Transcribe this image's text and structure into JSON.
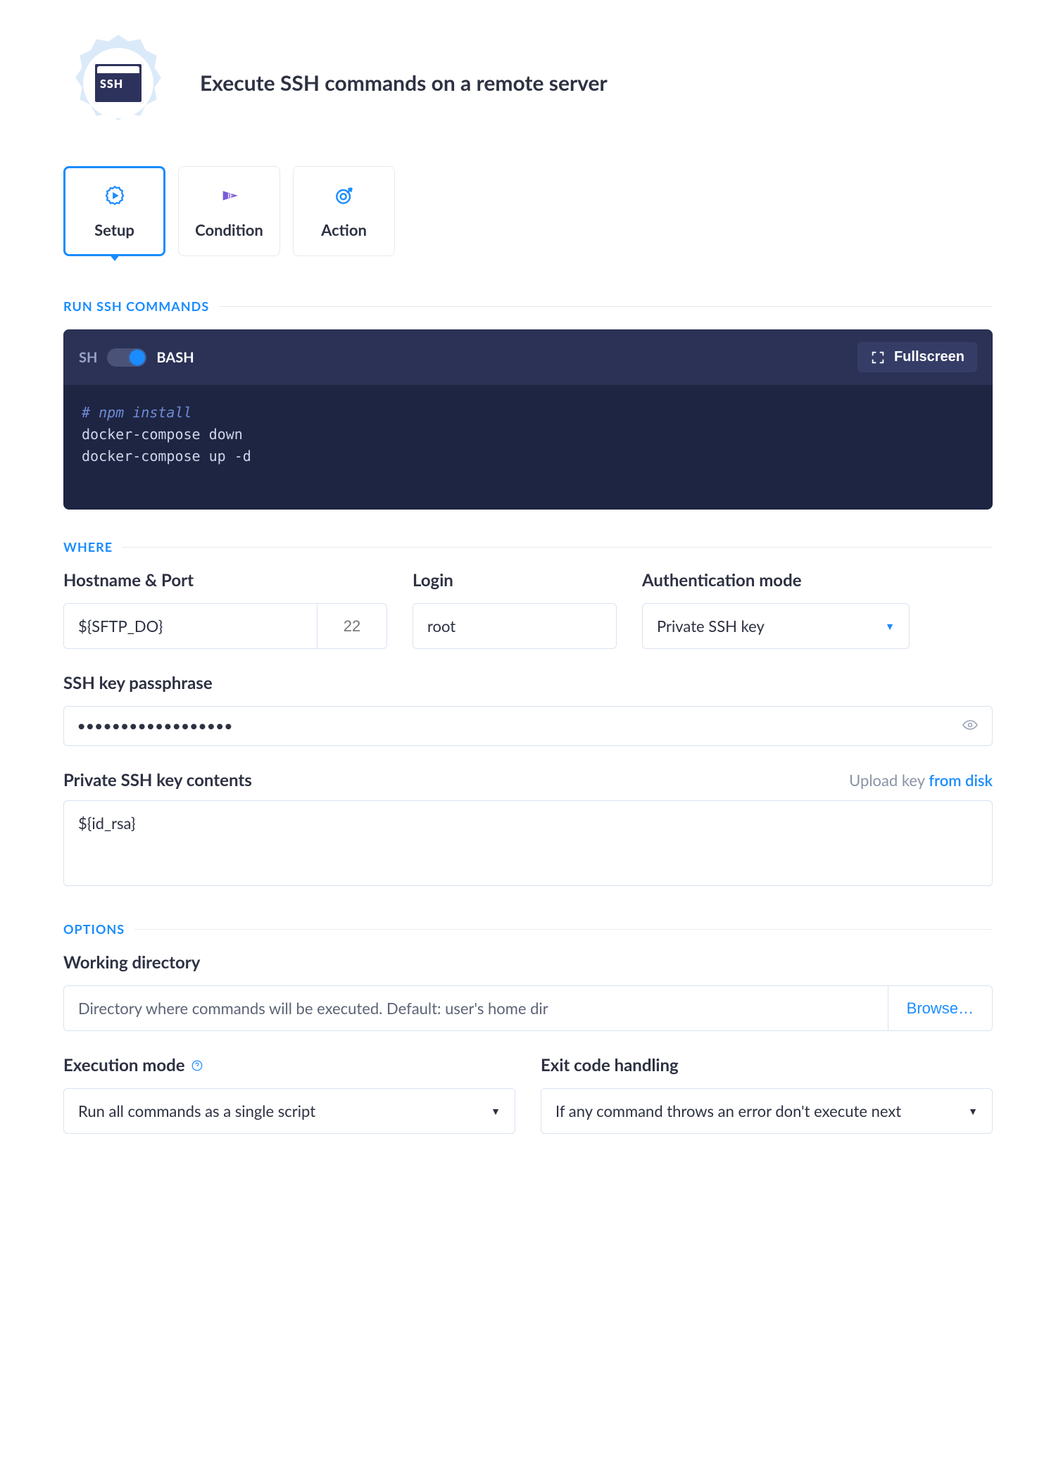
{
  "header": {
    "badge_text": "SSH",
    "title": "Execute SSH commands on a remote server"
  },
  "tabs": {
    "setup": "Setup",
    "condition": "Condition",
    "action": "Action"
  },
  "section_labels": {
    "run": "RUN SSH COMMANDS",
    "where": "WHERE",
    "options": "OPTIONS"
  },
  "code_panel": {
    "sh_label": "SH",
    "bash_label": "BASH",
    "fullscreen": "Fullscreen",
    "line1": "# npm install",
    "line2": "docker-compose down",
    "line3": "docker-compose up -d"
  },
  "where": {
    "hostname_label": "Hostname & Port",
    "hostname_value": "${SFTP_DO}",
    "port_placeholder": "22",
    "login_label": "Login",
    "login_value": "root",
    "auth_label": "Authentication mode",
    "auth_value": "Private SSH key",
    "passphrase_label": "SSH key passphrase",
    "passphrase_value": "••••••••••••••••••",
    "key_label": "Private SSH key contents",
    "upload_hint": "Upload key",
    "upload_link": "from disk",
    "key_value": "${id_rsa}"
  },
  "options": {
    "wd_label": "Working directory",
    "wd_placeholder": "Directory where commands will be executed. Default: user's home dir",
    "browse": "Browse…",
    "exec_label": "Execution mode",
    "exec_value": "Run all commands as a single script",
    "exit_label": "Exit code handling",
    "exit_value": "If any command throws an error don't execute next"
  }
}
